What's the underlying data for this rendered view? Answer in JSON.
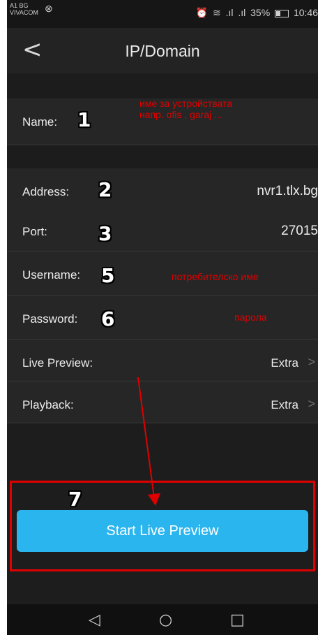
{
  "status_bar": {
    "carrier_line1": "A1 BG",
    "carrier_line2": "VIVACOM",
    "battery_percent": "35%",
    "time": "10:46"
  },
  "header": {
    "back_icon": "chevron-left-icon",
    "title": "IP/Domain"
  },
  "form": {
    "name": {
      "label": "Name:",
      "value": ""
    },
    "address": {
      "label": "Address:",
      "value": "nvr1.tlx.bg"
    },
    "port": {
      "label": "Port:",
      "value": "27015"
    },
    "username": {
      "label": "Username:",
      "value": ""
    },
    "password": {
      "label": "Password:",
      "value": ""
    },
    "live_preview": {
      "label": "Live Preview:",
      "value": "Extra"
    },
    "playback": {
      "label": "Playback:",
      "value": "Extra"
    }
  },
  "annotations": {
    "step1": "1",
    "step2": "2",
    "step3": "3",
    "step5": "5",
    "step6": "6",
    "step7": "7",
    "note_name_line1": "име за устройствата",
    "note_name_line2": "напр. ofis , garaj ...",
    "note_username": "потребителско име",
    "note_password": "парола",
    "highlight_color": "#e00000"
  },
  "start_button": {
    "label": "Start Live Preview",
    "color": "#2bb5ef"
  },
  "nav_bar": {
    "back": "◁",
    "home": "○",
    "recents": "□"
  }
}
